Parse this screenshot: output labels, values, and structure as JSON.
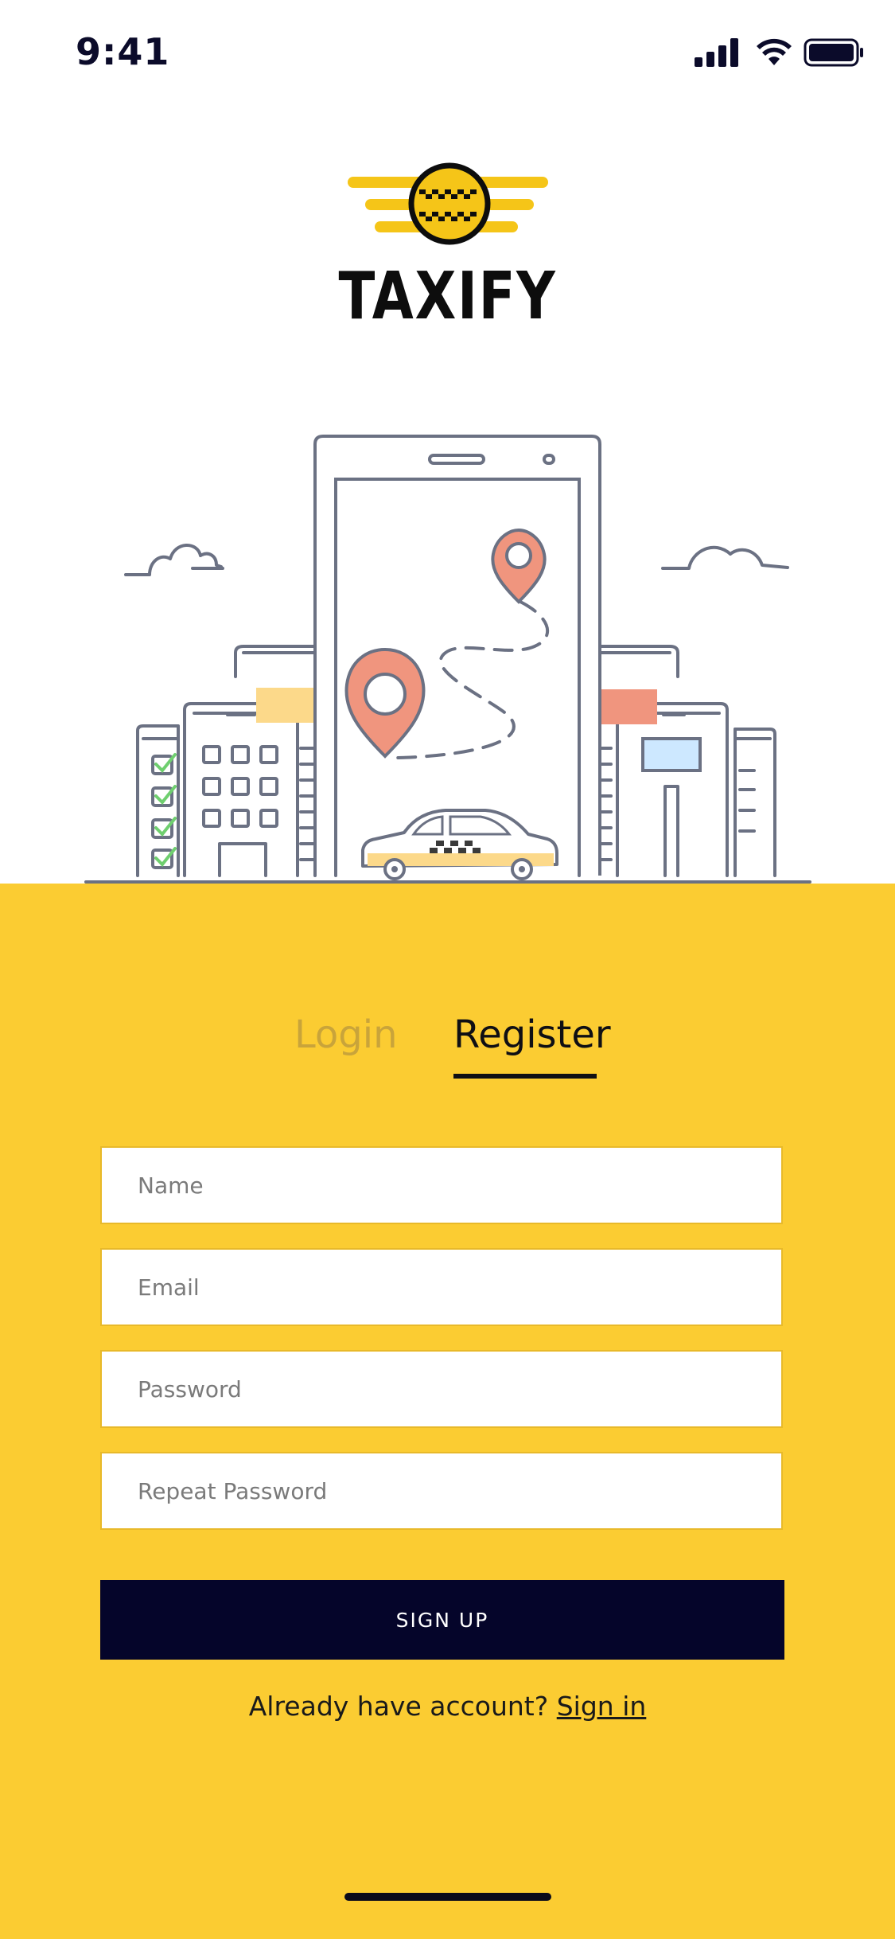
{
  "status_bar": {
    "time": "9:41",
    "icons": [
      "cellular-signal-icon",
      "wifi-icon",
      "battery-icon"
    ]
  },
  "brand": {
    "name": "TAXIFY",
    "logo_icon": "taxi-badge-logo"
  },
  "illustration": {
    "subject": "city-taxi-navigation-illustration"
  },
  "tabs": [
    {
      "label": "Login",
      "active": false
    },
    {
      "label": "Register",
      "active": true
    }
  ],
  "form": {
    "name_placeholder": "Name",
    "email_placeholder": "Email",
    "password_placeholder": "Password",
    "repeat_password_placeholder": "Repeat Password",
    "name_value": "",
    "email_value": "",
    "password_value": "",
    "repeat_password_value": ""
  },
  "actions": {
    "signup_label": "SIGN UP",
    "account_prompt": "Already have account?",
    "signin_label": "Sign in"
  },
  "colors": {
    "panel": "#fbcc32",
    "primary_button": "#05052a",
    "logo_yellow": "#f5c518",
    "pin_red": "#f0957e",
    "line_gray": "#6b7183"
  }
}
